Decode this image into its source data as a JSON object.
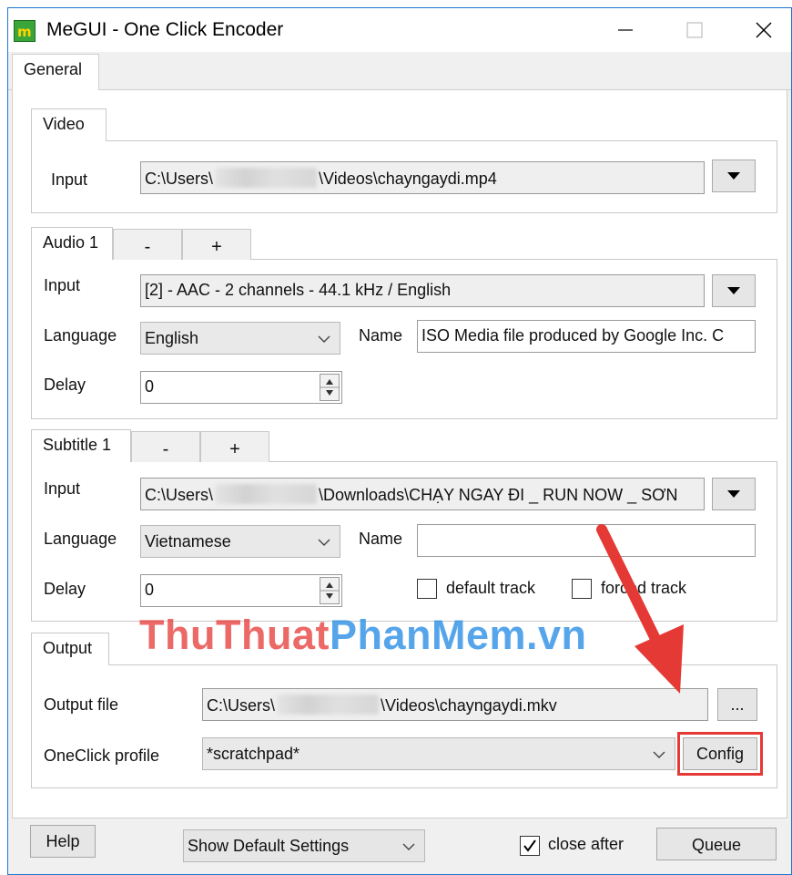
{
  "window": {
    "title": "MeGUI - One Click Encoder"
  },
  "tabs": {
    "general": "General"
  },
  "video": {
    "tab": "Video",
    "input_label": "Input",
    "input_prefix": "C:\\Users\\",
    "input_suffix": "\\Videos\\chayngaydi.mp4"
  },
  "audio": {
    "tab": "Audio 1",
    "remove_label": "-",
    "add_label": "+",
    "input_label": "Input",
    "input_value": "[2] - AAC - 2 channels - 44.1 kHz / English",
    "language_label": "Language",
    "language_value": "English",
    "name_label": "Name",
    "name_value": "ISO Media file produced by Google Inc. C",
    "delay_label": "Delay",
    "delay_value": "0"
  },
  "subtitle": {
    "tab": "Subtitle 1",
    "remove_label": "-",
    "add_label": "+",
    "input_label": "Input",
    "input_prefix": "C:\\Users\\",
    "input_suffix": "\\Downloads\\CHẠY NGAY ĐI _ RUN NOW _ SƠN",
    "language_label": "Language",
    "language_value": "Vietnamese",
    "name_label": "Name",
    "name_value": "",
    "delay_label": "Delay",
    "delay_value": "0",
    "default_track_label": "default track",
    "forced_track_label": "forced track"
  },
  "output": {
    "tab": "Output",
    "file_label": "Output file",
    "file_prefix": "C:\\Users\\",
    "file_suffix": "\\Videos\\chayngaydi.mkv",
    "browse_label": "...",
    "profile_label": "OneClick profile",
    "profile_value": "*scratchpad*",
    "config_label": "Config"
  },
  "footer": {
    "help_label": "Help",
    "settings_value": "Show Default Settings",
    "close_after_label": "close after",
    "queue_label": "Queue"
  },
  "watermark": "ThuThuatPhanMem.vn",
  "colors": {
    "highlight": "#e53935",
    "arrow": "#e53935",
    "title_border": "#1e78d0"
  }
}
